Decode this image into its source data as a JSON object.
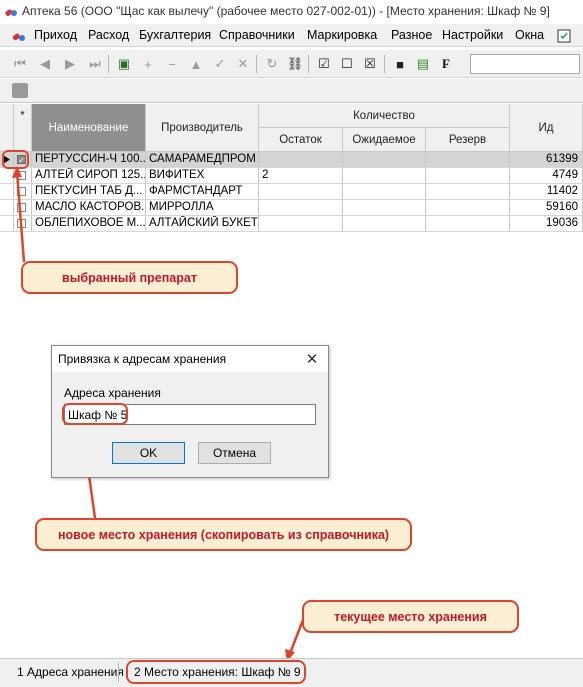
{
  "window": {
    "title": "Аптека 56 (ООО \"Щас как вылечу\" (рабочее место 027-002-01)) - [Место хранения: Шкаф № 9]"
  },
  "menu": [
    "Приход",
    "Расход",
    "Бухгалтерия",
    "Справочники",
    "Маркировка",
    "Разное",
    "Настройки",
    "Окна"
  ],
  "grid": {
    "headers": {
      "marker": "*",
      "name": "Наименование",
      "manufacturer": "Производитель",
      "quantity": "Количество",
      "remaining": "Остаток",
      "expected": "Ожидаемое",
      "reserve": "Резерв",
      "id": "Ид"
    },
    "rows": [
      {
        "name": "ПЕРТУССИН-Ч 100...",
        "manufacturer": "САМАРАМЕДПРОМ",
        "remaining": "",
        "expected": "",
        "reserve": "",
        "id": "61399",
        "checked": true,
        "current": true
      },
      {
        "name": "АЛТЕЙ СИРОП 125...",
        "manufacturer": "ВИФИТЕХ",
        "remaining": "2",
        "expected": "",
        "reserve": "",
        "id": "4749",
        "checked": false,
        "current": false
      },
      {
        "name": "ПЕКТУСИН ТАБ Д...",
        "manufacturer": "ФАРМСТАНДАРТ",
        "remaining": "",
        "expected": "",
        "reserve": "",
        "id": "11402",
        "checked": false,
        "current": false
      },
      {
        "name": "МАСЛО КАСТОРОВ...",
        "manufacturer": "МИРРОЛЛА",
        "remaining": "",
        "expected": "",
        "reserve": "",
        "id": "59160",
        "checked": false,
        "current": false
      },
      {
        "name": "ОБЛЕПИХОВОЕ М...",
        "manufacturer": "АЛТАЙСКИЙ БУКЕТ",
        "remaining": "",
        "expected": "",
        "reserve": "",
        "id": "19036",
        "checked": false,
        "current": false
      }
    ]
  },
  "dialog": {
    "title": "Привязка к адресам хранения",
    "field_label": "Адреса хранения",
    "field_value": "Шкаф № 5",
    "ok_label": "OK",
    "cancel_label": "Отмена"
  },
  "callouts": {
    "selected": "выбранный препарат",
    "new_location": "новое место хранения (скопировать из справочника)",
    "current_location": "текущее место хранения"
  },
  "tabs": [
    "1 Адреса хранения",
    "2 Место хранения: Шкаф № 9"
  ],
  "colors": {
    "callout_fill": "#fbeed2",
    "callout_border": "#e0442b",
    "callout_text": "#c2192a",
    "current_row": "#d4d4d4"
  }
}
